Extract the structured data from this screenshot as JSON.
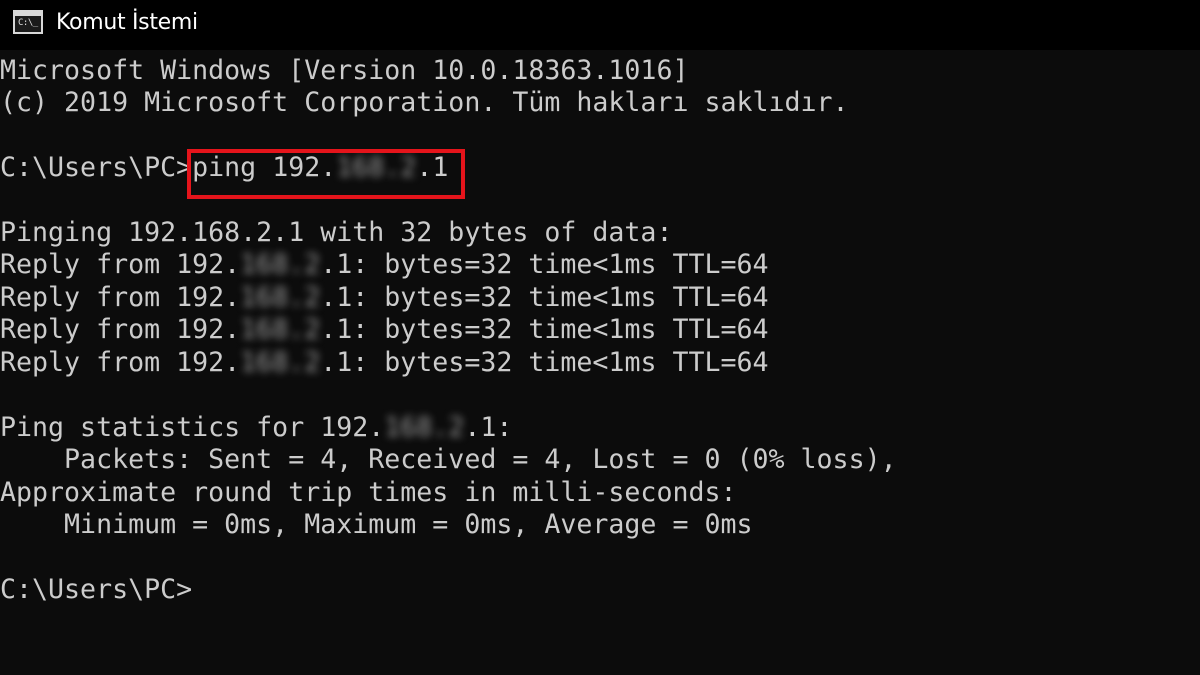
{
  "window": {
    "title": "Komut İstemi",
    "icon": "cmd-icon",
    "icon_glyph": "C:\\_"
  },
  "console": {
    "line1": "Microsoft Windows [Version 10.0.18363.1016]",
    "line2": "(c) 2019 Microsoft Corporation. Tüm hakları saklıdır.",
    "prompt1": "C:\\Users\\PC>",
    "cmd_pre": "ping 192.",
    "cmd_post": ".1",
    "pinging": "Pinging 192.168.2.1 with 32 bytes of data:",
    "replies": [
      {
        "pre": "Reply from 192.",
        "post": ".1: bytes=32 time<1ms TTL=64"
      },
      {
        "pre": "Reply from 192.",
        "post": ".1: bytes=32 time<1ms TTL=64"
      },
      {
        "pre": "Reply from 192.",
        "post": ".1: bytes=32 time<1ms TTL=64"
      },
      {
        "pre": "Reply from 192.",
        "post": ".1: bytes=32 time<1ms TTL=64"
      }
    ],
    "stats_pre": "Ping statistics for 192.",
    "stats_post": ".1:",
    "packets": "    Packets: Sent = 4, Received = 4, Lost = 0 (0% loss),",
    "approx": "Approximate round trip times in milli-seconds:",
    "times": "    Minimum = 0ms, Maximum = 0ms, Average = 0ms",
    "prompt2": "C:\\Users\\PC>"
  },
  "colors": {
    "background": "#0c0c0c",
    "text": "#cccccc",
    "highlight_border": "#e5141b"
  }
}
